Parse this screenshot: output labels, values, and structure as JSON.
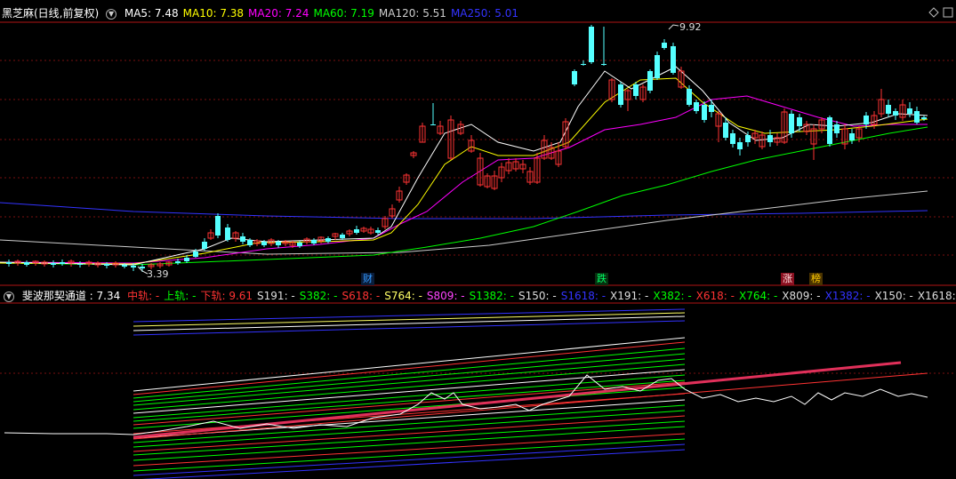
{
  "main_panel": {
    "title": "黑芝麻(日线,前复权)",
    "indicators": [
      {
        "label": "MA5: 7.48",
        "color": "#ffffff"
      },
      {
        "label": "MA10: 7.38",
        "color": "#ffff00"
      },
      {
        "label": "MA20: 7.24",
        "color": "#ff00ff"
      },
      {
        "label": "MA60: 7.19",
        "color": "#00ff00"
      },
      {
        "label": "MA120: 5.51",
        "color": "#cccccc"
      },
      {
        "label": "MA250: 5.01",
        "color": "#3333ff"
      }
    ],
    "high_label": "9.92",
    "low_label": "3.39",
    "event_tags": [
      {
        "text": "财",
        "color": "#3399ff"
      },
      {
        "text": "跌",
        "color": "#00ff66"
      },
      {
        "text": "涨",
        "color": "#ff3333"
      },
      {
        "text": "榜",
        "color": "#ffcc00"
      }
    ]
  },
  "sub_panel": {
    "title": "斐波那契通道 : 7.34",
    "indicators": [
      {
        "label": "中轨: -",
        "color": "#ff3333"
      },
      {
        "label": "上轨: -",
        "color": "#00ff00"
      },
      {
        "label": "下轨: 9.61",
        "color": "#ff3333"
      },
      {
        "label": "S191: -",
        "color": "#dddddd"
      },
      {
        "label": "S382: -",
        "color": "#00ff00"
      },
      {
        "label": "S618: -",
        "color": "#ff3333"
      },
      {
        "label": "S764: -",
        "color": "#ffff66"
      },
      {
        "label": "S809: -",
        "color": "#ff44ff"
      },
      {
        "label": "S1382: -",
        "color": "#00ff00"
      },
      {
        "label": "S150: -",
        "color": "#dddddd"
      },
      {
        "label": "S1618: -",
        "color": "#3333ff"
      },
      {
        "label": "X191: -",
        "color": "#dddddd"
      },
      {
        "label": "X382: -",
        "color": "#00ff00"
      },
      {
        "label": "X618: -",
        "color": "#ff3333"
      },
      {
        "label": "X764: -",
        "color": "#00ff00"
      },
      {
        "label": "X809: -",
        "color": "#dddddd"
      },
      {
        "label": "X1382: -",
        "color": "#3333ff"
      },
      {
        "label": "X150: -",
        "color": "#dddddd"
      },
      {
        "label": "X1618: -",
        "color": "#dddddd"
      }
    ]
  },
  "icons": {
    "collapse": "collapse-icon",
    "settings": "settings-icon",
    "window": "window-control-icon"
  }
}
